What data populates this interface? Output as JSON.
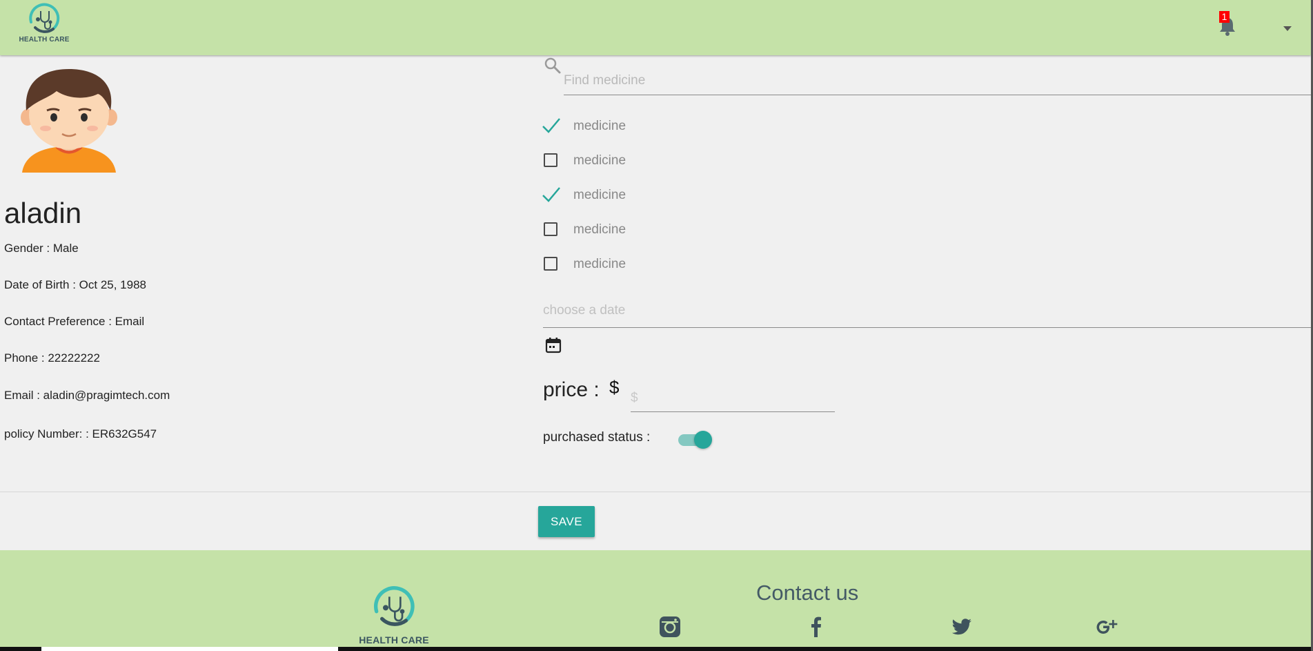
{
  "header": {
    "logo_text": "HEALTH CARE",
    "notification_count": "1"
  },
  "profile": {
    "name": "aladin",
    "gender": "Gender : Male",
    "dob": "Date of Birth : Oct 25, 1988",
    "contact_pref": "Contact Preference : Email",
    "phone": "Phone : 22222222",
    "email": "Email : aladin@pragimtech.com",
    "policy": "policy Number: : ER632G547"
  },
  "search": {
    "placeholder": "Find medicine",
    "value": ""
  },
  "medicines": [
    {
      "label": "medicine",
      "checked": true
    },
    {
      "label": "medicine",
      "checked": false
    },
    {
      "label": "medicine",
      "checked": true
    },
    {
      "label": "medicine",
      "checked": false
    },
    {
      "label": "medicine",
      "checked": false
    }
  ],
  "date": {
    "placeholder": "choose a date"
  },
  "price": {
    "label": "price :",
    "currency_symbol": "$",
    "placeholder": "$"
  },
  "purchased": {
    "label": "purchased status :",
    "on": true
  },
  "actions": {
    "save_label": "SAVE"
  },
  "footer": {
    "logo_text": "HEALTH CARE",
    "contact_title": "Contact us",
    "social": [
      "instagram-icon",
      "facebook-icon",
      "twitter-icon",
      "google-plus-icon"
    ]
  },
  "colors": {
    "header_bg": "#c5e2a8",
    "accent": "#26a69a",
    "badge": "#ff0000"
  }
}
